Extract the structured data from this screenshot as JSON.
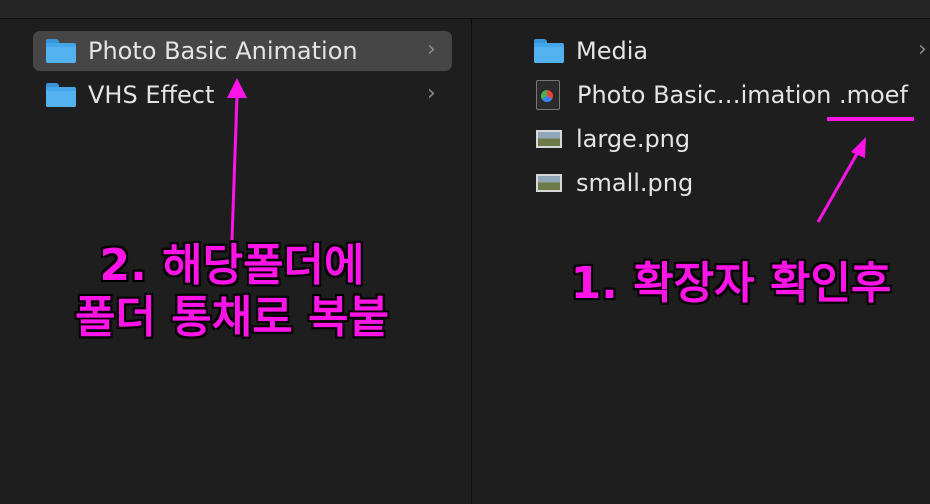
{
  "left_column": {
    "items": [
      {
        "label": "Photo Basic Animation",
        "selected": true
      },
      {
        "label": "VHS Effect",
        "selected": false
      }
    ]
  },
  "right_column": {
    "items": [
      {
        "label": "Media",
        "type": "folder"
      },
      {
        "label": "Photo Basic…imation .moef",
        "type": "motion-file"
      },
      {
        "label": "large.png",
        "type": "image"
      },
      {
        "label": "small.png",
        "type": "image"
      }
    ]
  },
  "annotations": {
    "step2_line1": "2. 해당폴더에",
    "step2_line2": "폴더 통채로 복붙",
    "step1": "1. 확장자 확인후",
    "color": "#ff14e8"
  },
  "icons": {
    "folder": "folder-icon",
    "chevron": "chevron-right-icon",
    "motion_file": "motion-file-icon",
    "image": "image-file-icon"
  },
  "chevron_glyph": "›"
}
